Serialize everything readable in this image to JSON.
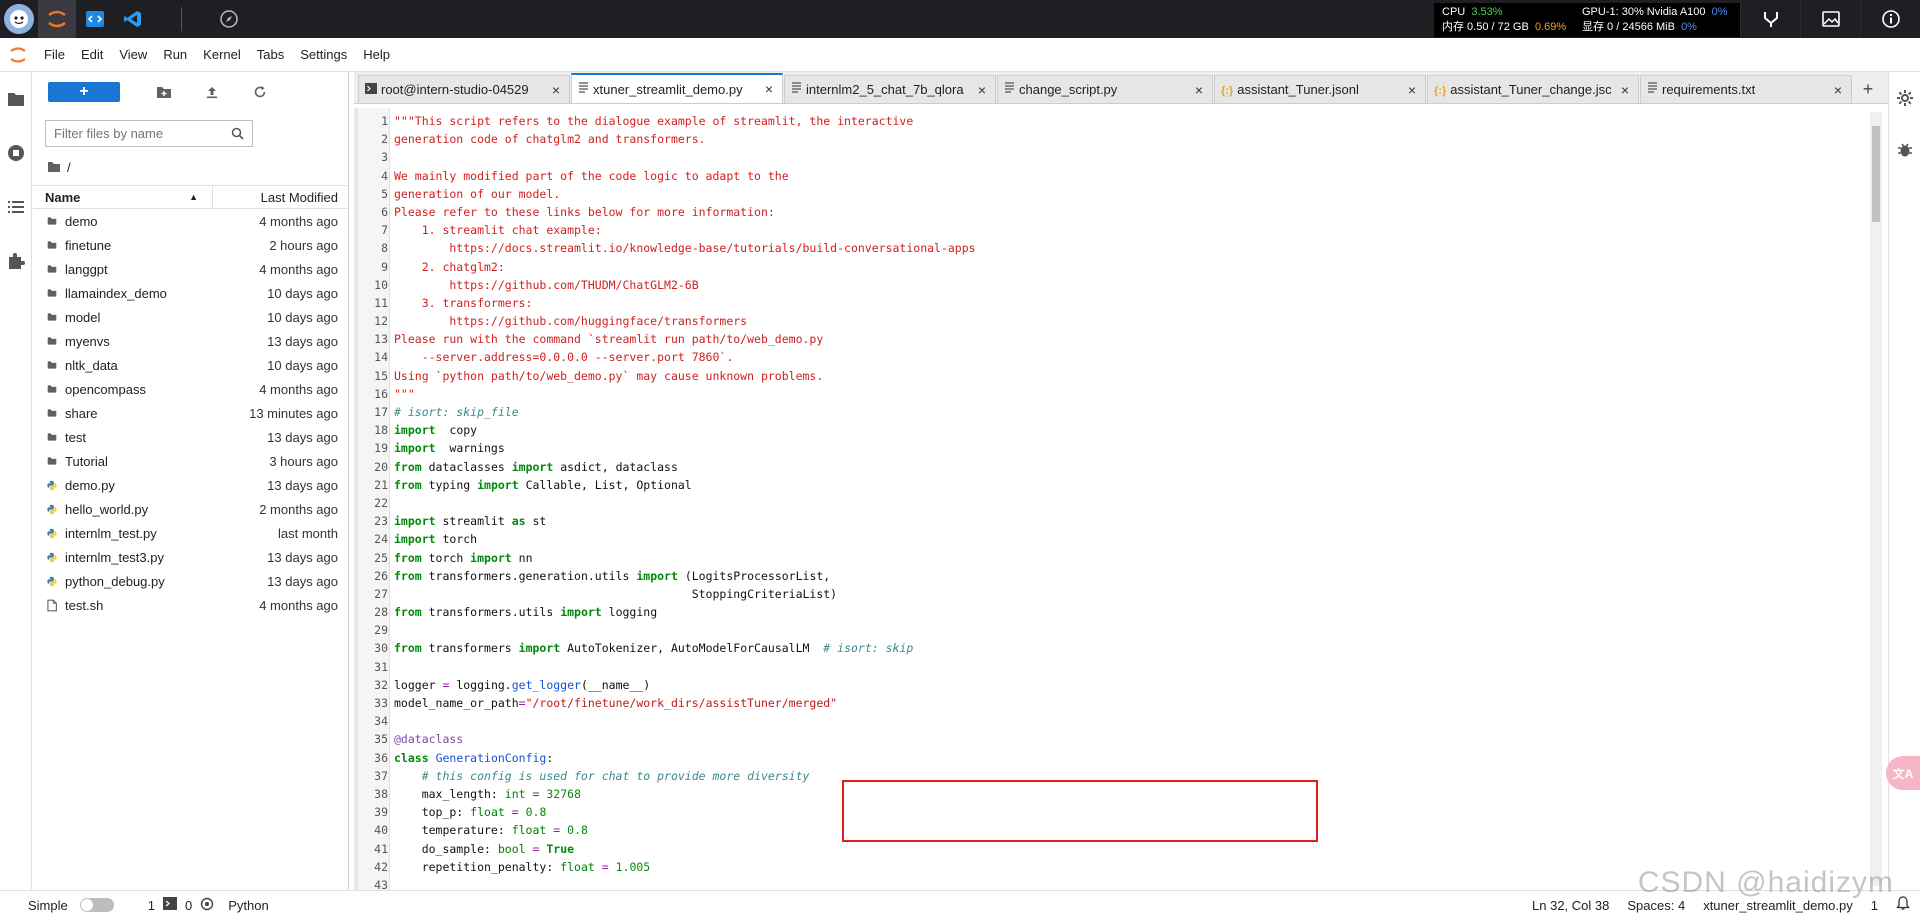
{
  "topbar": {
    "stats": {
      "cpu_label": "CPU",
      "cpu_value": "3.53%",
      "gpu_label": "GPU-1: 30% Nvidia A100",
      "gpu_value": "0%",
      "mem_label": "内存 0.50 / 72 GB",
      "mem_value": "0.69%",
      "vram_label": "显存 0 / 24566 MiB",
      "vram_value": "0%"
    }
  },
  "menu": [
    "File",
    "Edit",
    "View",
    "Run",
    "Kernel",
    "Tabs",
    "Settings",
    "Help"
  ],
  "filebrowser": {
    "filter_placeholder": "Filter files by name",
    "crumb": "/",
    "col_name": "Name",
    "col_modified": "Last Modified",
    "items": [
      {
        "name": "demo",
        "modified": "4 months ago",
        "type": "folder"
      },
      {
        "name": "finetune",
        "modified": "2 hours ago",
        "type": "folder"
      },
      {
        "name": "langgpt",
        "modified": "4 months ago",
        "type": "folder"
      },
      {
        "name": "llamaindex_demo",
        "modified": "10 days ago",
        "type": "folder"
      },
      {
        "name": "model",
        "modified": "10 days ago",
        "type": "folder"
      },
      {
        "name": "myenvs",
        "modified": "13 days ago",
        "type": "folder"
      },
      {
        "name": "nltk_data",
        "modified": "10 days ago",
        "type": "folder"
      },
      {
        "name": "opencompass",
        "modified": "4 months ago",
        "type": "folder"
      },
      {
        "name": "share",
        "modified": "13 minutes ago",
        "type": "folder"
      },
      {
        "name": "test",
        "modified": "13 days ago",
        "type": "folder"
      },
      {
        "name": "Tutorial",
        "modified": "3 hours ago",
        "type": "folder"
      },
      {
        "name": "demo.py",
        "modified": "13 days ago",
        "type": "python"
      },
      {
        "name": "hello_world.py",
        "modified": "2 months ago",
        "type": "python"
      },
      {
        "name": "internlm_test.py",
        "modified": "last month",
        "type": "python"
      },
      {
        "name": "internlm_test3.py",
        "modified": "13 days ago",
        "type": "python"
      },
      {
        "name": "python_debug.py",
        "modified": "13 days ago",
        "type": "python"
      },
      {
        "name": "test.sh",
        "modified": "4 months ago",
        "type": "file"
      }
    ]
  },
  "tabs": [
    {
      "title": "root@intern-studio-04529",
      "icon": "terminal",
      "active": false
    },
    {
      "title": "xtuner_streamlit_demo.py",
      "icon": "file",
      "active": true
    },
    {
      "title": "internlm2_5_chat_7b_qlora",
      "icon": "file",
      "active": false
    },
    {
      "title": "change_script.py",
      "icon": "file",
      "active": false
    },
    {
      "title": "assistant_Tuner.jsonl",
      "icon": "json",
      "active": false
    },
    {
      "title": "assistant_Tuner_change.jsc",
      "icon": "json",
      "active": false
    },
    {
      "title": "requirements.txt",
      "icon": "file",
      "active": false
    }
  ],
  "code_lines": [
    [
      [
        "cm",
        "\"\"\"This script refers to the dialogue example of streamlit, the interactive"
      ]
    ],
    [
      [
        "cm",
        "generation code of chatglm2 and transformers."
      ]
    ],
    [
      [
        "cm",
        ""
      ]
    ],
    [
      [
        "cm",
        "We mainly modified part of the code logic to adapt to the"
      ]
    ],
    [
      [
        "cm",
        "generation of our model."
      ]
    ],
    [
      [
        "cm",
        "Please refer to these links below for more information:"
      ]
    ],
    [
      [
        "cm",
        "    1. streamlit chat example:"
      ]
    ],
    [
      [
        "cm",
        "        https://docs.streamlit.io/knowledge-base/tutorials/build-conversational-apps"
      ]
    ],
    [
      [
        "cm",
        "    2. chatglm2:"
      ]
    ],
    [
      [
        "cm",
        "        https://github.com/THUDM/ChatGLM2-6B"
      ]
    ],
    [
      [
        "cm",
        "    3. transformers:"
      ]
    ],
    [
      [
        "cm",
        "        https://github.com/huggingface/transformers"
      ]
    ],
    [
      [
        "cm",
        "Please run with the command `streamlit run path/to/web_demo.py"
      ]
    ],
    [
      [
        "cm",
        "    --server.address=0.0.0.0 --server.port 7860`."
      ]
    ],
    [
      [
        "cm",
        "Using `python path/to/web_demo.py` may cause unknown problems."
      ]
    ],
    [
      [
        "cm",
        "\"\"\""
      ]
    ],
    [
      [
        "ci",
        "# isort: skip_file"
      ]
    ],
    [
      [
        "kw",
        "import"
      ],
      [
        "",
        "  copy"
      ]
    ],
    [
      [
        "kw",
        "import"
      ],
      [
        "",
        "  warnings"
      ]
    ],
    [
      [
        "kw",
        "from"
      ],
      [
        "",
        " dataclasses "
      ],
      [
        "kw",
        "import"
      ],
      [
        "",
        " asdict, dataclass"
      ]
    ],
    [
      [
        "kw",
        "from"
      ],
      [
        "",
        " typing "
      ],
      [
        "kw",
        "import"
      ],
      [
        "",
        " Callable, List, Optional"
      ]
    ],
    [
      [
        "",
        ""
      ]
    ],
    [
      [
        "kw",
        "import"
      ],
      [
        "",
        " streamlit "
      ],
      [
        "kw",
        "as"
      ],
      [
        "",
        " st"
      ]
    ],
    [
      [
        "kw",
        "import"
      ],
      [
        "",
        " torch"
      ]
    ],
    [
      [
        "kw",
        "from"
      ],
      [
        "",
        " torch "
      ],
      [
        "kw",
        "import"
      ],
      [
        "",
        " nn"
      ]
    ],
    [
      [
        "kw",
        "from"
      ],
      [
        "",
        " transformers.generation.utils "
      ],
      [
        "kw",
        "import"
      ],
      [
        "",
        " (LogitsProcessorList,"
      ]
    ],
    [
      [
        "",
        "                                           StoppingCriteriaList)"
      ]
    ],
    [
      [
        "kw",
        "from"
      ],
      [
        "",
        " transformers.utils "
      ],
      [
        "kw",
        "import"
      ],
      [
        "",
        " logging"
      ]
    ],
    [
      [
        "",
        ""
      ]
    ],
    [
      [
        "kw",
        "from"
      ],
      [
        "",
        " transformers "
      ],
      [
        "kw",
        "import"
      ],
      [
        "",
        " AutoTokenizer, AutoModelForCausalLM  "
      ],
      [
        "ci",
        "# isort: skip"
      ]
    ],
    [
      [
        "",
        ""
      ]
    ],
    [
      [
        "",
        "logger "
      ],
      [
        "op",
        "="
      ],
      [
        "",
        " logging."
      ],
      [
        "fn",
        "get_logger"
      ],
      [
        "",
        "(__name__)"
      ]
    ],
    [
      [
        "",
        "model_name_or_path"
      ],
      [
        "op",
        "="
      ],
      [
        "st",
        "\"/root/finetune/work_dirs/assistTuner/merged\""
      ]
    ],
    [
      [
        "",
        ""
      ]
    ],
    [
      [
        "dc",
        "@dataclass"
      ]
    ],
    [
      [
        "kw",
        "class"
      ],
      [
        "",
        " "
      ],
      [
        "fn",
        "GenerationConfig"
      ],
      [
        "",
        ":"
      ]
    ],
    [
      [
        "ci",
        "    # this config is used for chat to provide more diversity"
      ]
    ],
    [
      [
        "",
        "    max_length: "
      ],
      [
        "bi",
        "int"
      ],
      [
        "",
        " "
      ],
      [
        "op",
        "="
      ],
      [
        "",
        " "
      ],
      [
        "nu",
        "32768"
      ]
    ],
    [
      [
        "",
        "    top_p: "
      ],
      [
        "bi",
        "float"
      ],
      [
        "",
        " "
      ],
      [
        "op",
        "="
      ],
      [
        "",
        " "
      ],
      [
        "nu",
        "0.8"
      ]
    ],
    [
      [
        "",
        "    temperature: "
      ],
      [
        "bi",
        "float"
      ],
      [
        "",
        " "
      ],
      [
        "op",
        "="
      ],
      [
        "",
        " "
      ],
      [
        "nu",
        "0.8"
      ]
    ],
    [
      [
        "",
        "    do_sample: "
      ],
      [
        "bi",
        "bool"
      ],
      [
        "",
        " "
      ],
      [
        "op",
        "="
      ],
      [
        "",
        " "
      ],
      [
        "kw",
        "True"
      ]
    ],
    [
      [
        "",
        "    repetition_penalty: "
      ],
      [
        "bi",
        "float"
      ],
      [
        "",
        " "
      ],
      [
        "op",
        "="
      ],
      [
        "",
        " "
      ],
      [
        "nu",
        "1.005"
      ]
    ],
    [
      [
        "",
        ""
      ]
    ]
  ],
  "statusbar": {
    "mode": "Simple",
    "terminals": "1",
    "kernels": "0",
    "kernel_name": "Python",
    "position": "Ln 32, Col 38",
    "spaces": "Spaces: 4",
    "filename": "xtuner_streamlit_demo.py",
    "count": "1"
  },
  "watermark": "CSDN @haidizym",
  "colors": {
    "accent": "#1976d2",
    "highlight": "#e02020"
  }
}
